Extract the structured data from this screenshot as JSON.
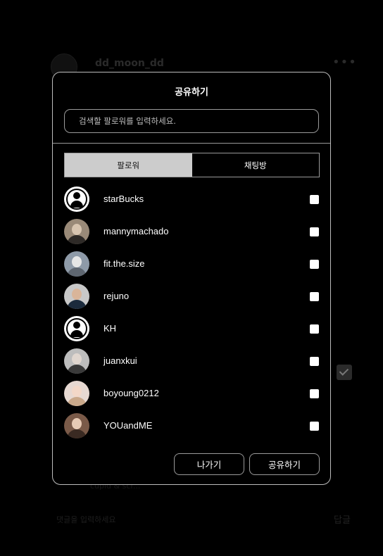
{
  "background": {
    "username": "dd_moon_dd",
    "more": "•••",
    "comment_placeholder": "댓글을 입력하세요",
    "reply_label": "답글",
    "faint_text": "cupid & scr..."
  },
  "modal": {
    "title": "공유하기",
    "search_placeholder": "검색할 팔로워를 입력하세요.",
    "tabs": [
      {
        "label": "팔로워",
        "active": true
      },
      {
        "label": "채팅방",
        "active": false
      }
    ],
    "followers": [
      {
        "name": "starBucks",
        "avatar": "default"
      },
      {
        "name": "mannymachado",
        "avatar": "photo",
        "tone": "#9a8a78",
        "face": "#d8c5b0",
        "shoulders": "#2e2a27"
      },
      {
        "name": "fit.the.size",
        "avatar": "photo",
        "tone": "#8e9aa8",
        "face": "#e6e6e6",
        "shoulders": "#5e6670"
      },
      {
        "name": "rejuno",
        "avatar": "photo",
        "tone": "#c8c8c8",
        "face": "#d9b59a",
        "shoulders": "#1b2a3c"
      },
      {
        "name": "KH",
        "avatar": "default"
      },
      {
        "name": "juanxkui",
        "avatar": "photo",
        "tone": "#bdbdbd",
        "face": "#e0d6cf",
        "shoulders": "#3a3a3a"
      },
      {
        "name": "boyoung0212",
        "avatar": "photo",
        "tone": "#e7d9d2",
        "face": "#f3d8c8",
        "shoulders": "#c9a88a"
      },
      {
        "name": "YOUandME",
        "avatar": "photo",
        "tone": "#7a5a48",
        "face": "#e8cbb5",
        "shoulders": "#3a2a22"
      }
    ],
    "buttons": {
      "exit": "나가기",
      "share": "공유하기"
    }
  }
}
